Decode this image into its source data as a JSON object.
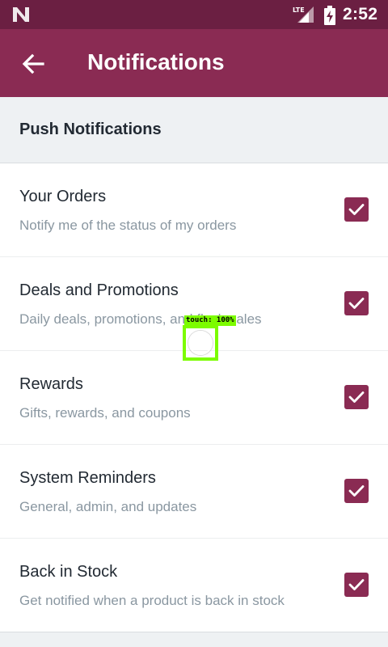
{
  "status_bar": {
    "time": "2:52",
    "network_label": "LTE",
    "icons": [
      "n-logo-icon",
      "lte-signal-icon",
      "battery-charging-icon"
    ]
  },
  "app_bar": {
    "title": "Notifications",
    "back_icon": "arrow-left-icon"
  },
  "section": {
    "title": "Push Notifications"
  },
  "items": [
    {
      "title": "Your Orders",
      "subtitle": "Notify me of the status of my orders",
      "checked": true
    },
    {
      "title": "Deals and Promotions",
      "subtitle": "Daily deals, promotions, and flash sales",
      "checked": true
    },
    {
      "title": "Rewards",
      "subtitle": "Gifts, rewards, and coupons",
      "checked": true
    },
    {
      "title": "System Reminders",
      "subtitle": "General, admin, and updates",
      "checked": true
    },
    {
      "title": "Back in Stock",
      "subtitle": "Get notified when a product is back in stock",
      "checked": true
    }
  ],
  "touch_indicator": {
    "label": "touch: 100%"
  },
  "colors": {
    "status_bar": "#6b1f42",
    "app_bar": "#8a2b53",
    "checkbox": "#8a2b53",
    "touch_highlight": "#7cfc00"
  }
}
